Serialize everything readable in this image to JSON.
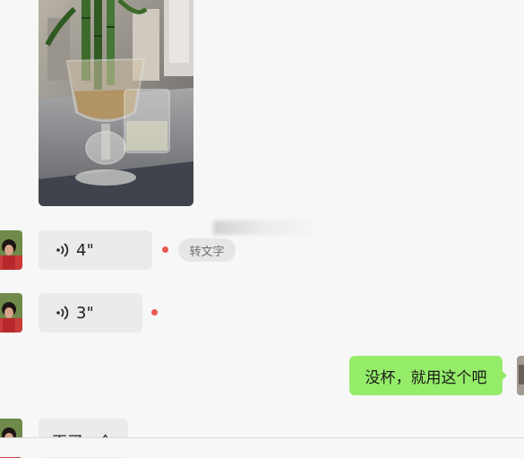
{
  "chat": {
    "messages": [
      {
        "type": "image",
        "from": "other",
        "image": "photo of lucky bamboo in a glass goblet next to a glass of water"
      },
      {
        "type": "voice",
        "from": "other",
        "duration": "4\"",
        "unread": true,
        "convert_label": "转文字"
      },
      {
        "type": "voice",
        "from": "other",
        "duration": "3\"",
        "unread": true
      },
      {
        "type": "text",
        "from": "me",
        "text": "没杯，就用这个吧"
      },
      {
        "type": "text",
        "from": "other",
        "text": "再买一个"
      }
    ]
  },
  "colors": {
    "background": "#f7f7f7",
    "incoming_bubble": "#ebebeb",
    "outgoing_bubble": "#95ec69",
    "unread_dot": "#e8584f"
  },
  "icons": {
    "voice": "voice-wave-icon"
  }
}
